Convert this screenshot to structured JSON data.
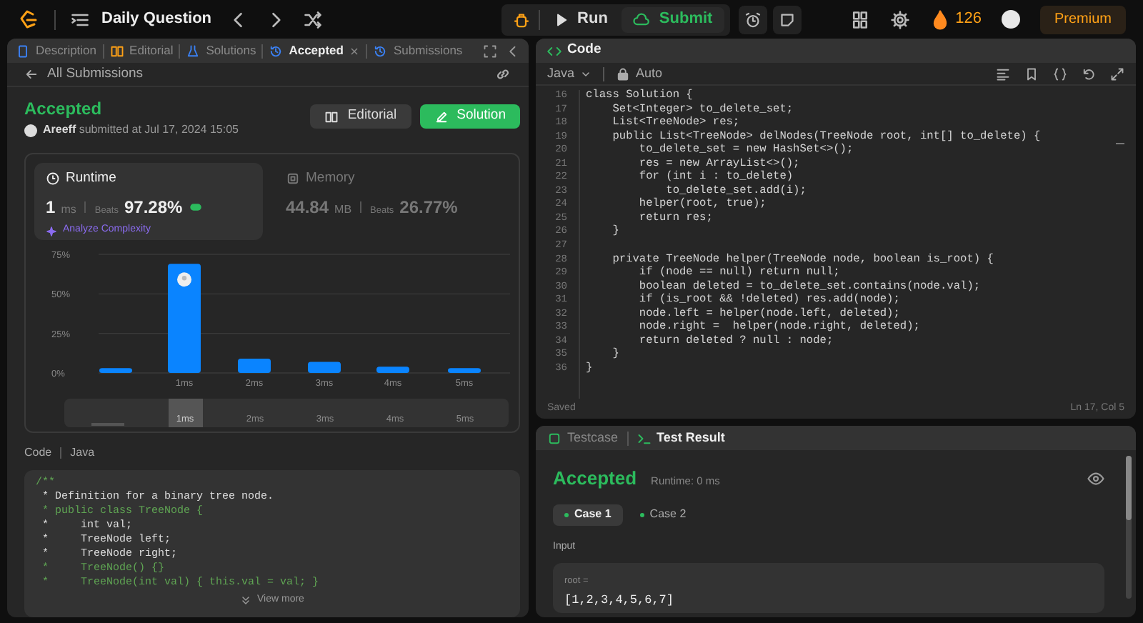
{
  "topbar": {
    "title": "Daily Question",
    "run": "Run",
    "submit": "Submit",
    "streak": "126",
    "premium": "Premium"
  },
  "left_panel": {
    "tabs": [
      {
        "label": "Description",
        "selected": false,
        "closable": false
      },
      {
        "label": "Editorial",
        "selected": false,
        "closable": false
      },
      {
        "label": "Solutions",
        "selected": false,
        "closable": false
      },
      {
        "label": "Accepted",
        "selected": true,
        "closable": true
      },
      {
        "label": "Submissions",
        "selected": false,
        "closable": false
      }
    ],
    "back_link": "All Submissions",
    "status": "Accepted",
    "submitted": "**Areeff** submitted at Jul 17, 2024 15:05",
    "buttons": [
      {
        "label": "Editorial",
        "kind": "secondary"
      },
      {
        "label": "Solution",
        "kind": "primary"
      }
    ],
    "metrics": [
      {
        "title": "Runtime",
        "value": "1",
        "unit": "ms",
        "beats_label": "Beats",
        "beats": "97.28%",
        "selected": true,
        "link": "Analyze Complexity"
      },
      {
        "title": "Memory",
        "value": "44.84",
        "unit": "MB",
        "beats_label": "Beats",
        "beats": "26.77%",
        "selected": false
      }
    ],
    "chart_data": {
      "type": "bar",
      "categories": [
        null,
        "1ms",
        "2ms",
        "3ms",
        "4ms",
        "5ms"
      ],
      "values": [
        3,
        69,
        9,
        7,
        4,
        3
      ],
      "ylim": [
        0,
        75
      ],
      "yticks": [
        {
          "value": 0,
          "label": "0%"
        },
        {
          "value": 25,
          "label": "25%"
        },
        {
          "value": 50,
          "label": "50%"
        },
        {
          "value": 75,
          "label": "75%"
        }
      ]
    },
    "range_selector": [
      {
        "label": "1ms",
        "selected": true
      },
      {
        "label": "2ms",
        "selected": false
      },
      {
        "label": "3ms",
        "selected": false
      },
      {
        "label": "4ms",
        "selected": false
      },
      {
        "label": "5ms",
        "selected": false
      }
    ],
    "code_label": "Code",
    "code_language": "Java",
    "snippet": [
      {
        "text": "/**",
        "kind": "comment"
      },
      {
        "text": " * Definition for a binary tree node.",
        "kind": "text"
      },
      {
        "text": " * public class TreeNode {",
        "kind": "comment"
      },
      {
        "text": " *     int val;",
        "kind": "text"
      },
      {
        "text": " *     TreeNode left;",
        "kind": "text"
      },
      {
        "text": " *     TreeNode right;",
        "kind": "text"
      },
      {
        "text": " *     TreeNode() {}",
        "kind": "comment"
      },
      {
        "text": " *     TreeNode(int val) { this.val = val; }",
        "kind": "comment"
      }
    ],
    "view_more": "View more"
  },
  "code_panel": {
    "tab": "Code",
    "language": "Java",
    "mode": "Auto",
    "lines": [
      {
        "number": "16",
        "text": "class Solution {"
      },
      {
        "number": "17",
        "text": "    Set<Integer> to_delete_set;"
      },
      {
        "number": "18",
        "text": "    List<TreeNode> res;"
      },
      {
        "number": "19",
        "text": "    public List<TreeNode> delNodes(TreeNode root, int[] to_delete) {"
      },
      {
        "number": "20",
        "text": "        to_delete_set = new HashSet<>();"
      },
      {
        "number": "21",
        "text": "        res = new ArrayList<>();"
      },
      {
        "number": "22",
        "text": "        for (int i : to_delete)"
      },
      {
        "number": "23",
        "text": "            to_delete_set.add(i);"
      },
      {
        "number": "24",
        "text": "        helper(root, true);"
      },
      {
        "number": "25",
        "text": "        return res;"
      },
      {
        "number": "26",
        "text": "    }"
      },
      {
        "number": "27"
      },
      {
        "number": "28",
        "text": "    private TreeNode helper(TreeNode node, boolean is_root) {"
      },
      {
        "number": "29",
        "text": "        if (node == null) return null;"
      },
      {
        "number": "30",
        "text": "        boolean deleted = to_delete_set.contains(node.val);"
      },
      {
        "number": "31",
        "text": "        if (is_root && !deleted) res.add(node);"
      },
      {
        "number": "32",
        "text": "        node.left = helper(node.left, deleted);"
      },
      {
        "number": "33",
        "text": "        node.right =  helper(node.right, deleted);"
      },
      {
        "number": "34",
        "text": "        return deleted ? null : node;"
      },
      {
        "number": "35",
        "text": "    }"
      },
      {
        "number": "36",
        "text": "}"
      }
    ],
    "status": "Saved",
    "cursor": "Ln 17, Col 5"
  },
  "test_panel": {
    "tabs": [
      {
        "label": "Testcase",
        "selected": false
      },
      {
        "label": "Test Result",
        "selected": true
      }
    ],
    "result": "Accepted",
    "runtime": "Runtime: 0 ms",
    "cases": [
      {
        "label": "Case 1",
        "selected": true
      },
      {
        "label": "Case 2",
        "selected": false
      }
    ],
    "input_label": "Input",
    "param": "root =",
    "value": "[1,2,3,4,5,6,7]"
  }
}
